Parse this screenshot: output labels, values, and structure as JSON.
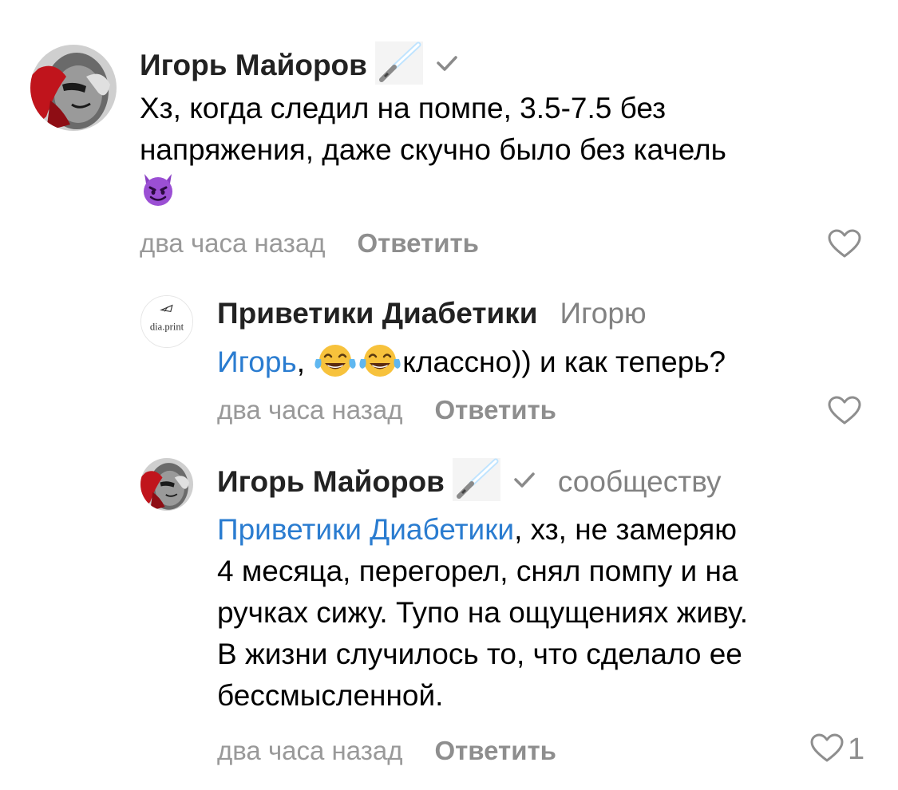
{
  "comments": [
    {
      "author": "Игорь Майоров",
      "text_lines": [
        "Хз, когда следил на помпе, 3.5-7.5 без",
        "напряжения, даже скучно было без качель"
      ],
      "emoji": "smiling-devil",
      "time": "два часа назад",
      "reply_label": "Ответить"
    },
    {
      "author": "Приветики Диабетики",
      "avatar_text": "dia.print",
      "reply_to": "Игорю",
      "mention": "Игорь",
      "text_after_mention": ", ",
      "text_after_emoji": "классно)) и как теперь?",
      "emoji": "tears-of-joy",
      "time": "два часа назад",
      "reply_label": "Ответить"
    },
    {
      "author": "Игорь Майоров",
      "reply_to": "сообществу",
      "mention": "Приветики Диабетики",
      "text_first": ", хз, не замеряю",
      "text_lines": [
        "4 месяца, перегорел, снял помпу и на",
        "ручках сижу. Тупо на ощущениях живу.",
        "В жизни случилось то, что сделало ее",
        "бессмысленной."
      ],
      "time": "два часа назад",
      "reply_label": "Ответить",
      "likes": "1"
    }
  ],
  "colors": {
    "link": "#2a7cd0",
    "meta": "#999999",
    "author": "#222222"
  },
  "icons": [
    "lightsaber-icon",
    "verified-check-icon",
    "heart-outline-icon"
  ]
}
